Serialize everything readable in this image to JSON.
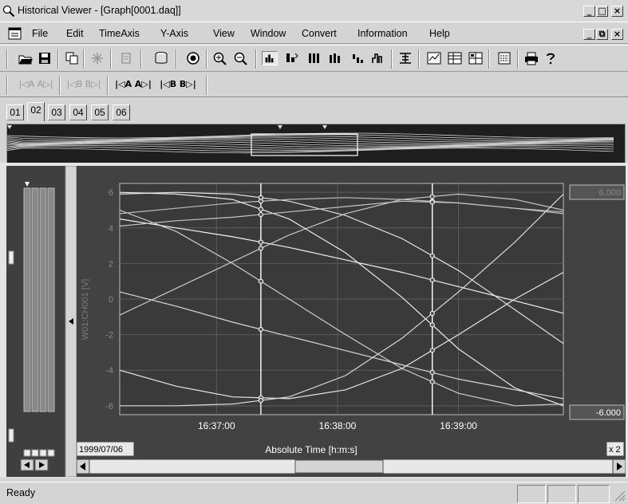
{
  "window": {
    "title": "Historical Viewer - [Graph[0001.daq]]"
  },
  "title_buttons": [
    "_",
    "□",
    "×"
  ],
  "menu": {
    "items": [
      {
        "label": "File"
      },
      {
        "label": "Edit"
      },
      {
        "label": "TimeAxis"
      },
      {
        "label": "Y-Axis"
      },
      {
        "label": "View"
      },
      {
        "label": "Window"
      },
      {
        "label": "Convert"
      },
      {
        "label": "Information"
      },
      {
        "label": "Help"
      }
    ],
    "doc_buttons": [
      "_",
      "⧉",
      "×"
    ]
  },
  "toolbar1": [
    {
      "icon": "open-folder-icon"
    },
    {
      "icon": "save-icon"
    },
    {
      "icon": "copy-icon"
    },
    {
      "icon": "sparkle-icon"
    },
    {
      "icon": "stamp-icon"
    },
    {
      "icon": "cylinder-icon"
    },
    {
      "icon": "target-icon"
    },
    {
      "icon": "zoom-in-icon"
    },
    {
      "icon": "zoom-out-icon"
    },
    {
      "icon": "cursor-bars-icon"
    },
    {
      "icon": "cursor-split-icon"
    },
    {
      "icon": "bars-icon"
    },
    {
      "icon": "bars-small-icon"
    },
    {
      "icon": "bars-mini-icon"
    },
    {
      "icon": "bars-step-icon"
    },
    {
      "icon": "digital-icon"
    },
    {
      "icon": "trend-icon"
    },
    {
      "icon": "table-icon"
    },
    {
      "icon": "grid-icon"
    },
    {
      "icon": "calculator-icon"
    },
    {
      "icon": "print-icon"
    },
    {
      "icon": "help-icon"
    }
  ],
  "toolbar2": [
    {
      "label": "|◁A A▷|"
    },
    {
      "label": "|◁B B▷|"
    },
    {
      "label": "|◁A A▷|"
    },
    {
      "label": "|◁B B▷|"
    }
  ],
  "tabs": [
    {
      "label": "01",
      "active": false
    },
    {
      "label": "02",
      "active": true
    },
    {
      "label": "03",
      "active": false
    },
    {
      "label": "04",
      "active": false
    },
    {
      "label": "05",
      "active": false
    },
    {
      "label": "06",
      "active": false
    }
  ],
  "graph": {
    "date_label": "1999/07/06",
    "x_axis_title": "Absolute Time [h:m:s]",
    "y_axis_title": "W01:CH001 [V]",
    "zoom_label": "x 2",
    "upper_limit_label": "6.000",
    "lower_limit_label": "-6.000"
  },
  "chart_data": {
    "type": "line",
    "xlabel": "Absolute Time [h:m:s]",
    "ylabel": "W01:CH001 [V]",
    "x_ticks": [
      "16:37:00",
      "16:38:00",
      "16:39:00"
    ],
    "y_ticks": [
      6,
      4,
      2,
      0,
      -2,
      -4,
      -6
    ],
    "ylim": [
      -6.5,
      6.5
    ],
    "xlim": [
      "16:36:12",
      "16:39:52"
    ],
    "grid": true,
    "cursors": [
      {
        "name": "A",
        "x": "16:37:22"
      },
      {
        "name": "B",
        "x": "16:38:47"
      }
    ],
    "series": [
      {
        "x": [
          "16:36:12",
          "16:36:40",
          "16:37:08",
          "16:37:36",
          "16:38:04",
          "16:38:32",
          "16:39:00",
          "16:39:28",
          "16:39:52"
        ],
        "values": [
          5.9,
          6.0,
          5.9,
          5.5,
          4.7,
          3.4,
          1.6,
          -0.6,
          -2.5
        ]
      },
      {
        "x": [
          "16:36:12",
          "16:36:40",
          "16:37:08",
          "16:37:36",
          "16:38:04",
          "16:38:32",
          "16:39:00",
          "16:39:28",
          "16:39:52"
        ],
        "values": [
          5.0,
          3.8,
          2.0,
          0.0,
          -2.0,
          -3.9,
          -5.3,
          -6.0,
          -5.9
        ]
      },
      {
        "x": [
          "16:36:12",
          "16:36:40",
          "16:37:08",
          "16:37:36",
          "16:38:04",
          "16:38:32",
          "16:39:00",
          "16:39:28",
          "16:39:52"
        ],
        "values": [
          4.5,
          4.0,
          3.5,
          2.9,
          2.2,
          1.5,
          0.7,
          -0.1,
          -0.8
        ]
      },
      {
        "x": [
          "16:36:12",
          "16:36:40",
          "16:37:08",
          "16:37:36",
          "16:38:04",
          "16:38:32",
          "16:39:00",
          "16:39:28",
          "16:39:52"
        ],
        "values": [
          0.4,
          -0.4,
          -1.3,
          -2.1,
          -2.9,
          -3.7,
          -4.5,
          -5.1,
          -5.6
        ]
      },
      {
        "x": [
          "16:36:12",
          "16:36:40",
          "16:37:08",
          "16:37:36",
          "16:38:04",
          "16:38:32",
          "16:39:00",
          "16:39:28",
          "16:39:52"
        ],
        "values": [
          -0.9,
          0.6,
          2.1,
          3.6,
          4.8,
          5.6,
          5.9,
          5.6,
          5.0
        ]
      },
      {
        "x": [
          "16:36:12",
          "16:36:40",
          "16:37:08",
          "16:37:36",
          "16:38:04",
          "16:38:32",
          "16:39:00",
          "16:39:28",
          "16:39:52"
        ],
        "values": [
          -4.0,
          -4.9,
          -5.5,
          -5.6,
          -5.1,
          -3.9,
          -2.0,
          0.0,
          1.5
        ]
      },
      {
        "x": [
          "16:36:12",
          "16:36:40",
          "16:37:08",
          "16:37:36",
          "16:38:04",
          "16:38:32",
          "16:39:00",
          "16:39:28",
          "16:39:52"
        ],
        "values": [
          4.8,
          5.1,
          5.4,
          5.6,
          5.7,
          5.6,
          5.4,
          5.1,
          4.9
        ]
      },
      {
        "x": [
          "16:36:12",
          "16:36:40",
          "16:37:08",
          "16:37:36",
          "16:38:04",
          "16:38:32",
          "16:39:00",
          "16:39:28",
          "16:39:52"
        ],
        "values": [
          -6.0,
          -6.0,
          -5.9,
          -5.5,
          -4.3,
          -2.2,
          0.4,
          3.2,
          5.9
        ]
      },
      {
        "x": [
          "16:36:12",
          "16:36:40",
          "16:37:08",
          "16:37:36",
          "16:38:04",
          "16:38:32",
          "16:39:00",
          "16:39:28",
          "16:39:52"
        ],
        "values": [
          6.0,
          5.9,
          5.6,
          4.5,
          2.6,
          0.1,
          -2.8,
          -5.0,
          -6.0
        ]
      },
      {
        "x": [
          "16:36:12",
          "16:36:40",
          "16:37:08",
          "16:37:36",
          "16:38:04",
          "16:38:32",
          "16:39:00",
          "16:39:28",
          "16:39:52"
        ],
        "values": [
          4.1,
          4.4,
          4.6,
          4.9,
          5.2,
          5.5,
          5.4,
          5.1,
          4.8
        ]
      }
    ]
  },
  "status": {
    "text": "Ready"
  }
}
